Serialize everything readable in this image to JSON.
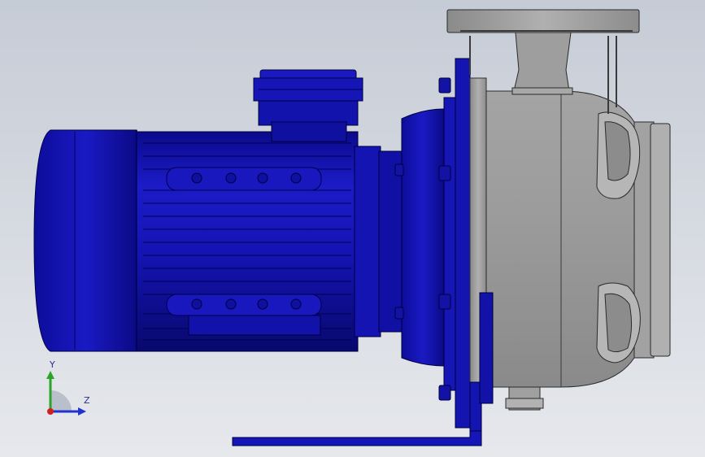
{
  "viewport": {
    "background_top": "#c6ccd6",
    "background_bottom": "#e6e8ec"
  },
  "model": {
    "motor_color": "#1414b4",
    "pump_color": "#9a9a9a"
  },
  "triad": {
    "y_label": "Y",
    "z_label": "Z",
    "y_color": "#2aa52a",
    "z_color": "#2233cc",
    "x_color": "#cc2222"
  }
}
